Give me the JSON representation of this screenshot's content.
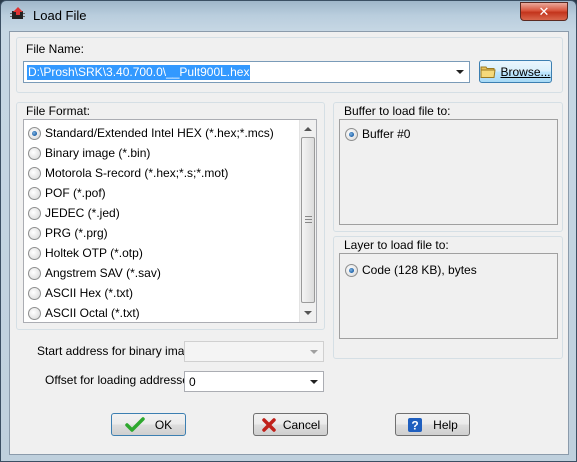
{
  "window": {
    "title": "Load File",
    "close_label": "✕"
  },
  "file_name": {
    "label": "File Name:",
    "value": "D:\\Prosh\\SRK\\3.40.700.0\\__Pult900L.hex",
    "browse_label": "Browse..."
  },
  "file_format": {
    "label": "File Format:",
    "selected_index": 0,
    "options": [
      "Standard/Extended Intel HEX (*.hex;*.mcs)",
      "Binary image (*.bin)",
      "Motorola S-record (*.hex;*.s;*.mot)",
      "POF (*.pof)",
      "JEDEC (*.jed)",
      "PRG (*.prg)",
      "Holtek OTP (*.otp)",
      "Angstrem SAV (*.sav)",
      "ASCII Hex (*.txt)",
      "ASCII Octal (*.txt)"
    ]
  },
  "buffer": {
    "label": "Buffer to load file to:",
    "option": "Buffer #0"
  },
  "layer": {
    "label": "Layer to load file to:",
    "option": "Code (128 KB), bytes"
  },
  "start_address": {
    "label": "Start address for binary image:",
    "value": ""
  },
  "offset": {
    "label": "Offset for loading addresses:",
    "value": "0"
  },
  "buttons": {
    "ok": "OK",
    "cancel": "Cancel",
    "help": "Help"
  },
  "colors": {
    "selection": "#3399ff",
    "ok_check": "#2ea82e",
    "cancel_x": "#c0211b",
    "help_icon": "#1f5fbf"
  }
}
